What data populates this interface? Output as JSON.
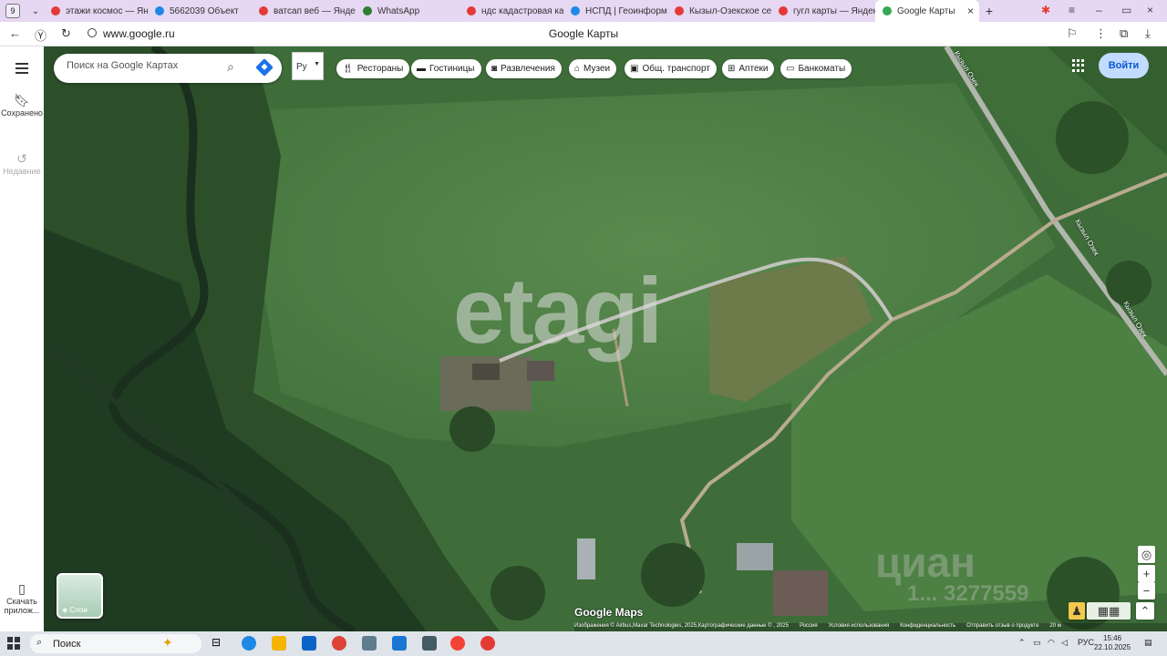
{
  "browser": {
    "tab_count": "9",
    "tabs": [
      {
        "label": "этажи космос — Янд",
        "icon": "yandex-icon",
        "color": "#e53935"
      },
      {
        "label": "5662039 Объект",
        "icon": "globe-icon",
        "color": "#1e88e5"
      },
      {
        "label": "ватсап веб — Яндекс",
        "icon": "yandex-icon",
        "color": "#e53935"
      },
      {
        "label": "WhatsApp",
        "icon": "whatsapp-icon",
        "color": "#2e7d32"
      },
      {
        "label": "ндс кадастровая ка",
        "icon": "yandex-icon",
        "color": "#e53935"
      },
      {
        "label": "НСПД | Геоинформа",
        "icon": "globe-icon",
        "color": "#1e88e5"
      },
      {
        "label": "Кызыл-Озекское сел",
        "icon": "maps-pin-icon",
        "color": "#e53935"
      },
      {
        "label": "гугл карты — Яндекс",
        "icon": "yandex-icon",
        "color": "#e53935"
      },
      {
        "label": "Google Карты",
        "icon": "google-maps-icon",
        "color": "#34a853"
      }
    ],
    "url": "www.google.ru",
    "page_title": "Google Карты"
  },
  "rail": {
    "saved_label": "Сохранено",
    "recent_label": "Недавние",
    "download_label": "Скачать прилож..."
  },
  "search": {
    "placeholder": "Поиск на Google Картах"
  },
  "language": {
    "value": "Ру"
  },
  "chips": [
    {
      "label": "Рестораны",
      "icon": "fork-knife-icon"
    },
    {
      "label": "Гостиницы",
      "icon": "bed-icon"
    },
    {
      "label": "Развлечения",
      "icon": "camera-icon"
    },
    {
      "label": "Музеи",
      "icon": "museum-icon"
    },
    {
      "label": "Общ. транспорт",
      "icon": "bus-icon"
    },
    {
      "label": "Аптеки",
      "icon": "pharmacy-icon"
    },
    {
      "label": "Банкоматы",
      "icon": "atm-icon"
    }
  ],
  "signin_label": "Войти",
  "layers_label": "Слои",
  "map": {
    "watermark": "etagi",
    "cian_watermark": "циан",
    "cian_id": "1... 3277559",
    "road_label": "Кызыл Озек",
    "road_label_2": "Кызыл Озек",
    "road_label_3": "Кызыл Озек",
    "google_maps_logo": "Google Maps",
    "attribution": [
      "Изображения © Airbus,Maxar Technologies, 2025,Картографические данные © , 2025",
      "Россия",
      "Условия использования",
      "Конфиденциальность",
      "Отправить отзыв о продукте",
      "20 м"
    ]
  },
  "taskbar": {
    "search_label": "Поиск",
    "lang": "РУС",
    "time": "15:46",
    "date": "22.10.2025"
  }
}
